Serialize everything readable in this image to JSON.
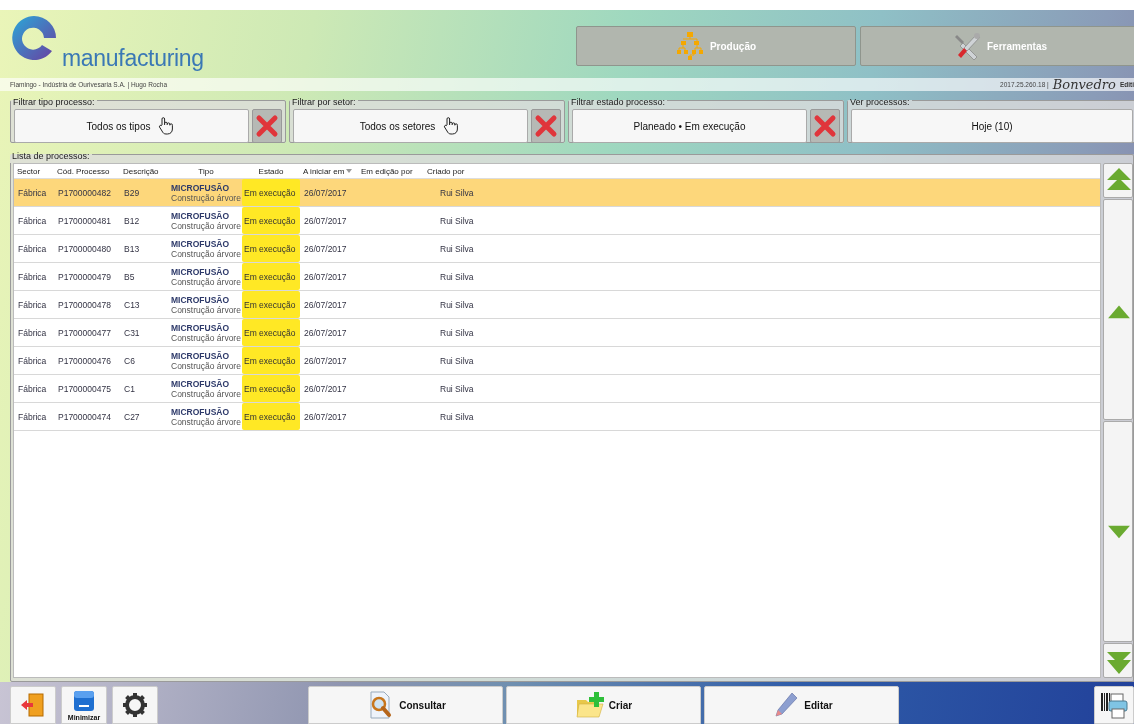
{
  "header": {
    "logo_text": "manufacturing",
    "nav_buttons": [
      {
        "kind": "hierarchy",
        "label": "Produção"
      },
      {
        "kind": "tools",
        "label": "Ferramentas"
      }
    ]
  },
  "info_bar": {
    "company_user": "Flamingo - Indústria de Ourivesaria S.A.  | Hugo Rocha",
    "version": "2017.25.260.18 |",
    "brand": "Bonvedro",
    "edition": "Editi"
  },
  "filters": [
    {
      "legend": "Filtrar tipo processo:",
      "value": "Todos os tipos",
      "pointer_icon": true,
      "clear_button": true
    },
    {
      "legend": "Filtrar por setor:",
      "value": "Todos os setores",
      "pointer_icon": true,
      "clear_button": true
    },
    {
      "legend": "Filtrar estado processo:",
      "value": "Planeado • Em execução",
      "pointer_icon": false,
      "clear_button": true
    },
    {
      "legend": "Ver processos:",
      "value": "Hoje (10)",
      "pointer_icon": false,
      "clear_button": false
    }
  ],
  "process_list": {
    "legend": "Lista de processos:",
    "columns": [
      {
        "label": "Sector",
        "sorted": false
      },
      {
        "label": "Cód. Processo",
        "sorted": false
      },
      {
        "label": "Descrição",
        "sorted": false
      },
      {
        "label": "Tipo",
        "sorted": false
      },
      {
        "label": "Estado",
        "sorted": false
      },
      {
        "label": "A iniciar em",
        "sorted": true
      },
      {
        "label": "Em edição por",
        "sorted": false
      },
      {
        "label": "Criado por",
        "sorted": false
      }
    ],
    "rows": [
      {
        "sector": "Fábrica",
        "code": "P1700000482",
        "description": "B29",
        "type": "MICROFUSÃO",
        "subtype": "Construção árvore",
        "state": "Em execução",
        "start": "26/07/2017",
        "created_by": "Rui Silva",
        "selected": true
      },
      {
        "sector": "Fábrica",
        "code": "P1700000481",
        "description": "B12",
        "type": "MICROFUSÃO",
        "subtype": "Construção árvore",
        "state": "Em execução",
        "start": "26/07/2017",
        "created_by": "Rui Silva",
        "selected": false
      },
      {
        "sector": "Fábrica",
        "code": "P1700000480",
        "description": "B13",
        "type": "MICROFUSÃO",
        "subtype": "Construção árvore",
        "state": "Em execução",
        "start": "26/07/2017",
        "created_by": "Rui Silva",
        "selected": false
      },
      {
        "sector": "Fábrica",
        "code": "P1700000479",
        "description": "B5",
        "type": "MICROFUSÃO",
        "subtype": "Construção árvore",
        "state": "Em execução",
        "start": "26/07/2017",
        "created_by": "Rui Silva",
        "selected": false
      },
      {
        "sector": "Fábrica",
        "code": "P1700000478",
        "description": "C13",
        "type": "MICROFUSÃO",
        "subtype": "Construção árvore",
        "state": "Em execução",
        "start": "26/07/2017",
        "created_by": "Rui Silva",
        "selected": false
      },
      {
        "sector": "Fábrica",
        "code": "P1700000477",
        "description": "C31",
        "type": "MICROFUSÃO",
        "subtype": "Construção árvore",
        "state": "Em execução",
        "start": "26/07/2017",
        "created_by": "Rui Silva",
        "selected": false
      },
      {
        "sector": "Fábrica",
        "code": "P1700000476",
        "description": "C6",
        "type": "MICROFUSÃO",
        "subtype": "Construção árvore",
        "state": "Em execução",
        "start": "26/07/2017",
        "created_by": "Rui Silva",
        "selected": false
      },
      {
        "sector": "Fábrica",
        "code": "P1700000475",
        "description": "C1",
        "type": "MICROFUSÃO",
        "subtype": "Construção árvore",
        "state": "Em execução",
        "start": "26/07/2017",
        "created_by": "Rui Silva",
        "selected": false
      },
      {
        "sector": "Fábrica",
        "code": "P1700000474",
        "description": "C27",
        "type": "MICROFUSÃO",
        "subtype": "Construção árvore",
        "state": "Em execução",
        "start": "26/07/2017",
        "created_by": "Rui Silva",
        "selected": false
      }
    ]
  },
  "toolbar": {
    "left_buttons": [
      {
        "kind": "exit"
      },
      {
        "kind": "minimize",
        "label": "Minimizar"
      },
      {
        "kind": "settings"
      }
    ],
    "actions": [
      {
        "kind": "view",
        "label": "Consultar"
      },
      {
        "kind": "create",
        "label": "Criar"
      },
      {
        "kind": "edit",
        "label": "Editar"
      }
    ],
    "right_buttons": [
      {
        "kind": "print"
      }
    ]
  }
}
